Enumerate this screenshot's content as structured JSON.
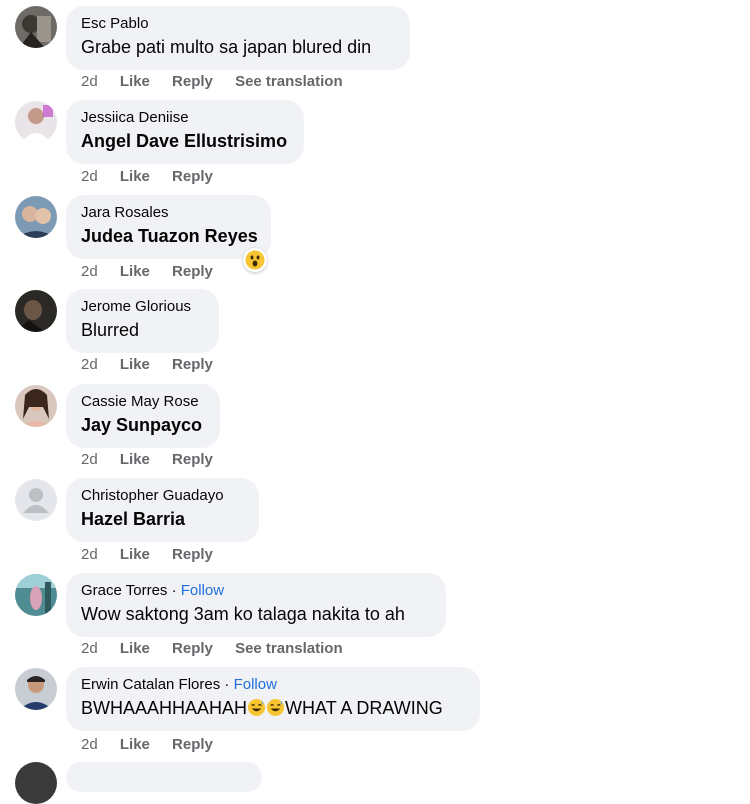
{
  "actions": {
    "time": "2d",
    "like": "Like",
    "reply": "Reply",
    "see_translation": "See translation"
  },
  "follow_label": "Follow",
  "separator": "·",
  "comments": [
    {
      "author": "Esc Pablo",
      "text": "Grabe pati multo sa japan blured din"
    },
    {
      "author": "Jessiica Deniise",
      "text": "Angel Dave Ellustrisimo"
    },
    {
      "author": "Jara Rosales",
      "text": "Judea Tuazon Reyes",
      "reaction": "wow-reaction-icon"
    },
    {
      "author": "Jerome Glorious",
      "text": "Blurred"
    },
    {
      "author": "Cassie May Rose",
      "text": "Jay Sunpayco"
    },
    {
      "author": "Christopher Guadayo",
      "text": "Hazel Barria"
    },
    {
      "author": "Grace Torres",
      "text": "Wow saktong 3am ko talaga nakita to ah"
    },
    {
      "author": "Erwin Catalan Flores",
      "text_before": "BWHAAAHHAAHAH",
      "text_after": "WHAT A DRAWING",
      "emojis": [
        "grinning-sweat-icon",
        "grinning-sweat-icon"
      ]
    }
  ],
  "colors": {
    "bubble": "#f0f2f5",
    "link": "#216fdb",
    "meta": "#65676b",
    "text": "#050505"
  }
}
